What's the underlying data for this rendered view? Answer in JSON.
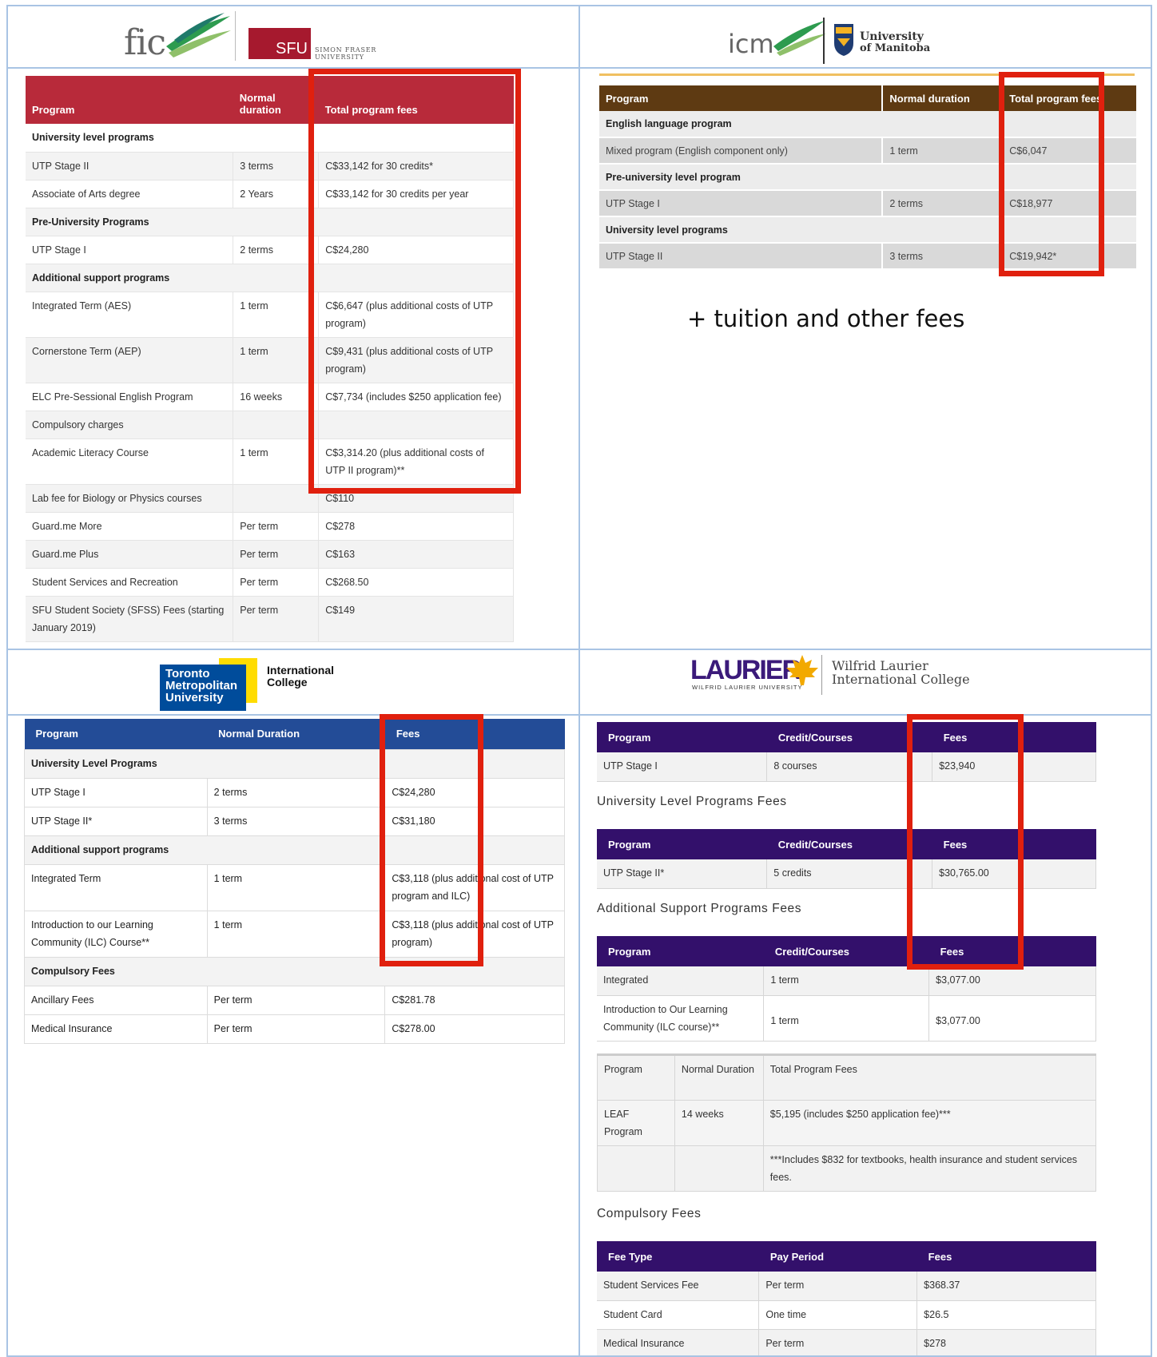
{
  "fic": {
    "logo_text": "fic",
    "partner_logo": "SFU",
    "partner_name": "SIMON FRASER UNIVERSITY",
    "headers": [
      "Program",
      "Normal duration",
      "Total program fees"
    ],
    "rows": [
      {
        "type": "section",
        "cells": [
          "University level programs"
        ]
      },
      {
        "type": "row",
        "cells": [
          "UTP Stage II",
          "3 terms",
          "C$33,142 for 30 credits*"
        ]
      },
      {
        "type": "row",
        "cells": [
          "Associate of Arts degree",
          "2 Years",
          "C$33,142 for 30 credits per year"
        ]
      },
      {
        "type": "section",
        "cells": [
          "Pre-University Programs"
        ]
      },
      {
        "type": "row",
        "cells": [
          "UTP Stage I",
          "2 terms",
          "C$24,280"
        ]
      },
      {
        "type": "section",
        "cells": [
          "Additional support programs"
        ]
      },
      {
        "type": "row",
        "tall": true,
        "cells": [
          "Integrated Term (AES)",
          "1 term",
          "C$6,647 (plus additional costs of UTP program)"
        ]
      },
      {
        "type": "row",
        "tall": true,
        "cells": [
          "Cornerstone Term (AEP)",
          "1 term",
          "C$9,431 (plus additional costs of UTP program)"
        ]
      },
      {
        "type": "row",
        "cells": [
          "ELC Pre-Sessional English Program",
          "16 weeks",
          "C$7,734 (includes $250 application fee)"
        ]
      },
      {
        "type": "row",
        "cells": [
          "Compulsory charges",
          "",
          ""
        ]
      },
      {
        "type": "row",
        "tall": true,
        "cells": [
          "Academic Literacy Course",
          "1 term",
          "C$3,314.20 (plus additional costs of UTP II program)**"
        ]
      },
      {
        "type": "row",
        "cells": [
          "Lab fee for Biology or Physics courses",
          "",
          "C$110"
        ]
      },
      {
        "type": "row",
        "cells": [
          "Guard.me More",
          "Per term",
          "C$278"
        ]
      },
      {
        "type": "row",
        "cells": [
          "Guard.me Plus",
          "Per term",
          "C$163"
        ]
      },
      {
        "type": "row",
        "cells": [
          "Student Services and Recreation",
          "Per term",
          "C$268.50"
        ]
      },
      {
        "type": "row",
        "tall": true,
        "cells": [
          "SFU Student Society (SFSS) Fees (starting January 2019)",
          "Per term",
          "C$149"
        ]
      }
    ]
  },
  "icm": {
    "logo_text": "icm",
    "partner_name_line1": "University",
    "partner_name_line2": "of Manitoba",
    "headers": [
      "Program",
      "Normal duration",
      "Total program fees"
    ],
    "rows": [
      {
        "type": "section",
        "cells": [
          "English language program"
        ]
      },
      {
        "type": "row",
        "cells": [
          "Mixed program (English component only)",
          "1 term",
          "C$6,047"
        ]
      },
      {
        "type": "section",
        "cells": [
          "Pre-university level program"
        ]
      },
      {
        "type": "row",
        "cells": [
          "UTP Stage I",
          "2 terms",
          "C$18,977"
        ]
      },
      {
        "type": "section",
        "cells": [
          "University level programs"
        ]
      },
      {
        "type": "row",
        "cells": [
          "UTP Stage II",
          "3 terms",
          "C$19,942*"
        ]
      }
    ],
    "note": "+ tuition and other fees"
  },
  "tmu": {
    "logo_line1": "Toronto",
    "logo_line2": "Metropolitan",
    "logo_line3": "University",
    "college_line1": "International",
    "college_line2": "College",
    "headers": [
      "Program",
      "Normal Duration",
      "Fees"
    ],
    "rows": [
      {
        "type": "section",
        "cells": [
          "University Level Programs"
        ]
      },
      {
        "type": "row",
        "cells": [
          "UTP Stage I",
          "2 terms",
          "C$24,280"
        ]
      },
      {
        "type": "row",
        "cells": [
          "UTP Stage II*",
          "3 terms",
          "C$31,180"
        ]
      },
      {
        "type": "section",
        "cells": [
          "Additional support programs"
        ]
      },
      {
        "type": "row",
        "tall": true,
        "cells": [
          "Integrated Term",
          "1 term",
          "C$3,118 (plus additional cost of UTP program and ILC)"
        ]
      },
      {
        "type": "row",
        "tall": true,
        "cells": [
          "Introduction to our Learning Community (ILC) Course**",
          "1 term",
          "C$3,118 (plus additional cost of UTP program)"
        ]
      },
      {
        "type": "section",
        "cells": [
          "Compulsory Fees"
        ]
      },
      {
        "type": "row",
        "cells": [
          "Ancillary Fees",
          "Per term",
          "C$281.78"
        ]
      },
      {
        "type": "row",
        "cells": [
          "Medical Insurance",
          "Per term",
          "C$278.00"
        ]
      }
    ]
  },
  "laurier": {
    "logo_text": "LAURIER",
    "logo_sub": "WILFRID LAURIER UNIVERSITY",
    "college_line1": "Wilfrid Laurier",
    "college_line2": "International College",
    "t1": {
      "headers": [
        "Program",
        "Credit/Courses",
        "Fees"
      ],
      "rows": [
        [
          "UTP Stage I",
          "8 courses",
          "$23,940"
        ]
      ]
    },
    "h2": "University Level Programs Fees",
    "t2": {
      "headers": [
        "Program",
        "Credit/Courses",
        "Fees"
      ],
      "rows": [
        [
          "UTP Stage II*",
          "5 credits",
          "$30,765.00"
        ]
      ]
    },
    "h3": "Additional Support Programs Fees",
    "t3": {
      "headers": [
        "Program",
        "Credit/Courses",
        "Fees"
      ],
      "rows": [
        [
          "Integrated",
          "1 term",
          "$3,077.00"
        ],
        [
          "Introduction to Our Learning Community (ILC course)**",
          "1 term",
          "$3,077.00"
        ]
      ]
    },
    "t4": {
      "headers": [
        "Program",
        "Normal Duration",
        "Total Program Fees"
      ],
      "rows": [
        [
          "LEAF Program",
          "14 weeks",
          "$5,195 (includes $250 application fee)***"
        ],
        [
          "",
          "",
          "***Includes $832 for textbooks, health insurance and student services fees."
        ]
      ]
    },
    "h5": "Compulsory Fees",
    "t5": {
      "headers": [
        "Fee Type",
        "Pay Period",
        "Fees"
      ],
      "rows": [
        [
          "Student Services Fee",
          "Per term",
          "$368.37"
        ],
        [
          "Student Card",
          "One time",
          "$26.5"
        ],
        [
          "Medical Insurance",
          "Per term",
          "$278"
        ]
      ]
    }
  }
}
